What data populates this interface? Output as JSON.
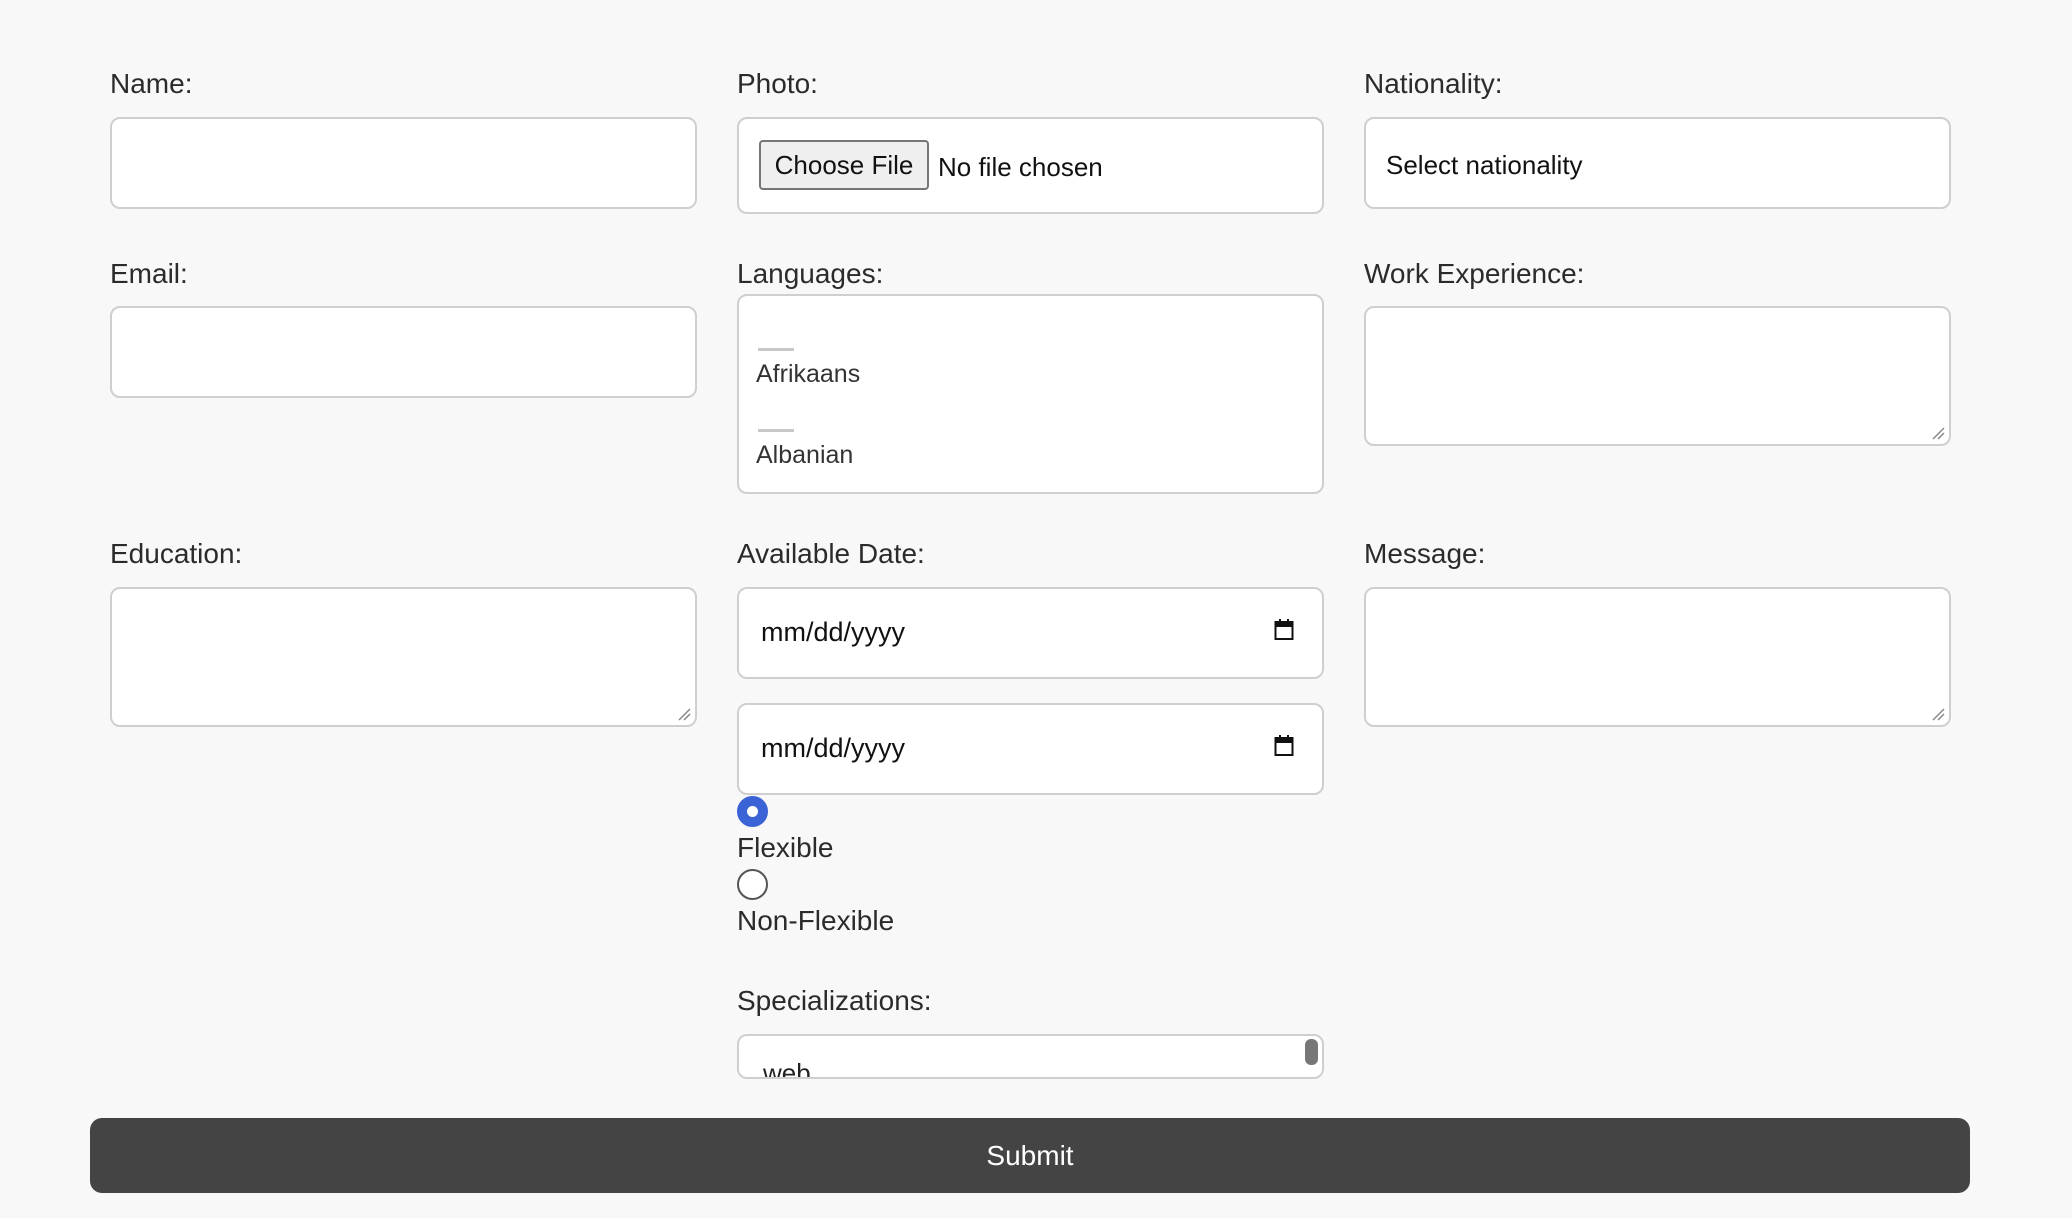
{
  "form": {
    "name_label": "Name:",
    "photo_label": "Photo:",
    "photo_button": "Choose File",
    "photo_status": "No file chosen",
    "nationality_label": "Nationality:",
    "nationality_selected": "Select nationality",
    "email_label": "Email:",
    "languages_label": "Languages:",
    "languages": [
      "Afrikaans",
      "Albanian"
    ],
    "work_label": "Work Experience:",
    "education_label": "Education:",
    "available_label": "Available Date:",
    "date1_placeholder": "mm/dd/yyyy",
    "date2_placeholder": "mm/dd/yyyy",
    "flexible_label": "Flexible",
    "nonflexible_label": "Non-Flexible",
    "message_label": "Message:",
    "specializations_label": "Specializations:",
    "specialization_first": "web",
    "submit_label": "Submit"
  },
  "colors": {
    "radio_checked": "#3a63d6",
    "submit_bg": "#444444",
    "page_bg": "#f8f8f8"
  }
}
